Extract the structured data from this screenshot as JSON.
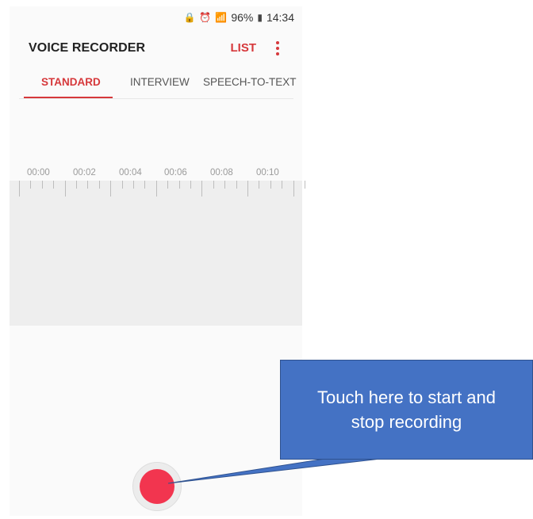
{
  "status_bar": {
    "battery": "96%",
    "time": "14:34"
  },
  "header": {
    "title": "VOICE RECORDER",
    "list_label": "LIST"
  },
  "tabs": [
    {
      "label": "STANDARD"
    },
    {
      "label": "INTERVIEW"
    },
    {
      "label": "SPEECH-TO-TEXT"
    }
  ],
  "timeline": {
    "times": [
      "00:00",
      "00:02",
      "00:04",
      "00:06",
      "00:08",
      "00:10"
    ]
  },
  "callout": {
    "line1": "Touch here to start and",
    "line2": "stop recording"
  },
  "colors": {
    "accent": "#d6383b",
    "record": "#f2354f",
    "callout": "#4472c4"
  }
}
